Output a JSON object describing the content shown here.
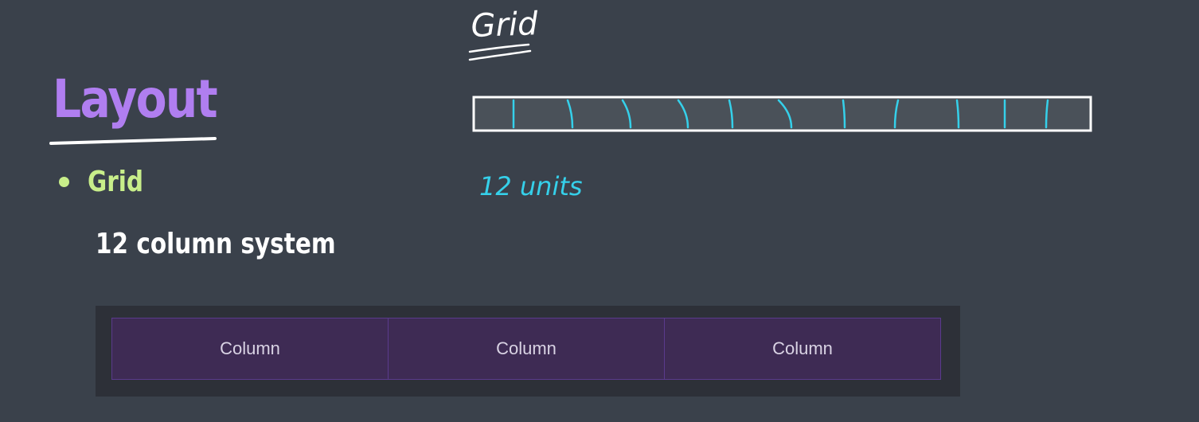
{
  "slide": {
    "title": "Layout",
    "bullet": "Grid",
    "subtext": "12 column system"
  },
  "annotations": {
    "heading": "Grid",
    "units_label": "12 units",
    "unit_count": 12
  },
  "demo": {
    "columns": [
      "Column",
      "Column",
      "Column"
    ]
  },
  "colors": {
    "background": "#3a414b",
    "title": "#b07ef0",
    "bullet": "#c8ee8a",
    "sketch": "#ffffff",
    "ink": "#35d0ea",
    "column_fill": "#3e2b54",
    "column_border": "#5a3a8c"
  }
}
